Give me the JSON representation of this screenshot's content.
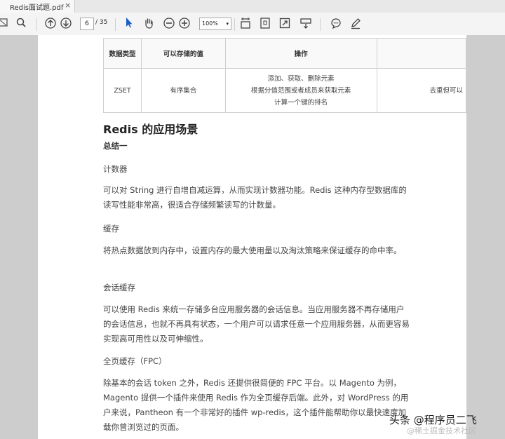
{
  "tab": {
    "title": "Redis面试题.pdf",
    "close": "×"
  },
  "toolbar": {
    "page_value": "6",
    "page_total": "/ 35",
    "zoom_value": "100%",
    "zoom_caret": "▾"
  },
  "table": {
    "headers": [
      "数据类型",
      "可以存储的值",
      "操作",
      ""
    ],
    "row": {
      "type": "ZSET",
      "value": "有序集合",
      "ops": [
        "添加、获取、删除元素",
        "根据分值范围或者成员来获取元素",
        "计算一个键的排名"
      ],
      "extra": "去重但可以"
    }
  },
  "content": {
    "heading": "Redis 的应用场景",
    "summary": "总结一",
    "sections": [
      {
        "title": "计数器",
        "body": "可以对 String 进行自增自减运算，从而实现计数器功能。Redis 这种内存型数据库的读写性能非常高，很适合存储频繁读写的计数量。"
      },
      {
        "title": "缓存",
        "body": "将热点数据放到内存中，设置内存的最大使用量以及淘汰策略来保证缓存的命中率。"
      },
      {
        "title": "会话缓存",
        "body": "可以使用 Redis 来统一存储多台应用服务器的会话信息。当应用服务器不再存储用户的会话信息，也就不再具有状态，一个用户可以请求任意一个应用服务器，从而更容易实现高可用性以及可伸缩性。"
      },
      {
        "title": "全页缓存（FPC）",
        "body": "除基本的会话 token 之外，Redis 还提供很简便的 FPC 平台。以 Magento 为例，Magento 提供一个插件来使用 Redis 作为全页缓存后端。此外，对 WordPress 的用户来说，Pantheon 有一个非常好的插件 wp-redis，这个插件能帮助你以最快速度加载你曾浏览过的页面。"
      }
    ]
  },
  "watermark": {
    "main": "头条 @程序员二飞",
    "sub": "@稀土掘金技术社区"
  }
}
